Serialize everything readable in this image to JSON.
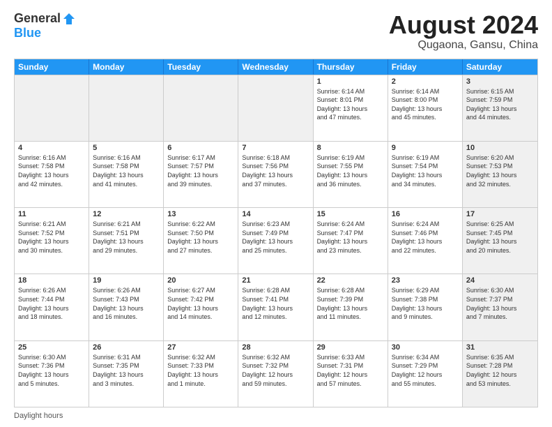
{
  "logo": {
    "general": "General",
    "blue": "Blue"
  },
  "title": "August 2024",
  "location": "Qugaona, Gansu, China",
  "header_days": [
    "Sunday",
    "Monday",
    "Tuesday",
    "Wednesday",
    "Thursday",
    "Friday",
    "Saturday"
  ],
  "footer": "Daylight hours",
  "weeks": [
    [
      {
        "day": "",
        "info": "",
        "shaded": true
      },
      {
        "day": "",
        "info": "",
        "shaded": true
      },
      {
        "day": "",
        "info": "",
        "shaded": true
      },
      {
        "day": "",
        "info": "",
        "shaded": true
      },
      {
        "day": "1",
        "info": "Sunrise: 6:14 AM\nSunset: 8:01 PM\nDaylight: 13 hours\nand 47 minutes.",
        "shaded": false
      },
      {
        "day": "2",
        "info": "Sunrise: 6:14 AM\nSunset: 8:00 PM\nDaylight: 13 hours\nand 45 minutes.",
        "shaded": false
      },
      {
        "day": "3",
        "info": "Sunrise: 6:15 AM\nSunset: 7:59 PM\nDaylight: 13 hours\nand 44 minutes.",
        "shaded": true
      }
    ],
    [
      {
        "day": "4",
        "info": "Sunrise: 6:16 AM\nSunset: 7:58 PM\nDaylight: 13 hours\nand 42 minutes.",
        "shaded": false
      },
      {
        "day": "5",
        "info": "Sunrise: 6:16 AM\nSunset: 7:58 PM\nDaylight: 13 hours\nand 41 minutes.",
        "shaded": false
      },
      {
        "day": "6",
        "info": "Sunrise: 6:17 AM\nSunset: 7:57 PM\nDaylight: 13 hours\nand 39 minutes.",
        "shaded": false
      },
      {
        "day": "7",
        "info": "Sunrise: 6:18 AM\nSunset: 7:56 PM\nDaylight: 13 hours\nand 37 minutes.",
        "shaded": false
      },
      {
        "day": "8",
        "info": "Sunrise: 6:19 AM\nSunset: 7:55 PM\nDaylight: 13 hours\nand 36 minutes.",
        "shaded": false
      },
      {
        "day": "9",
        "info": "Sunrise: 6:19 AM\nSunset: 7:54 PM\nDaylight: 13 hours\nand 34 minutes.",
        "shaded": false
      },
      {
        "day": "10",
        "info": "Sunrise: 6:20 AM\nSunset: 7:53 PM\nDaylight: 13 hours\nand 32 minutes.",
        "shaded": true
      }
    ],
    [
      {
        "day": "11",
        "info": "Sunrise: 6:21 AM\nSunset: 7:52 PM\nDaylight: 13 hours\nand 30 minutes.",
        "shaded": false
      },
      {
        "day": "12",
        "info": "Sunrise: 6:21 AM\nSunset: 7:51 PM\nDaylight: 13 hours\nand 29 minutes.",
        "shaded": false
      },
      {
        "day": "13",
        "info": "Sunrise: 6:22 AM\nSunset: 7:50 PM\nDaylight: 13 hours\nand 27 minutes.",
        "shaded": false
      },
      {
        "day": "14",
        "info": "Sunrise: 6:23 AM\nSunset: 7:49 PM\nDaylight: 13 hours\nand 25 minutes.",
        "shaded": false
      },
      {
        "day": "15",
        "info": "Sunrise: 6:24 AM\nSunset: 7:47 PM\nDaylight: 13 hours\nand 23 minutes.",
        "shaded": false
      },
      {
        "day": "16",
        "info": "Sunrise: 6:24 AM\nSunset: 7:46 PM\nDaylight: 13 hours\nand 22 minutes.",
        "shaded": false
      },
      {
        "day": "17",
        "info": "Sunrise: 6:25 AM\nSunset: 7:45 PM\nDaylight: 13 hours\nand 20 minutes.",
        "shaded": true
      }
    ],
    [
      {
        "day": "18",
        "info": "Sunrise: 6:26 AM\nSunset: 7:44 PM\nDaylight: 13 hours\nand 18 minutes.",
        "shaded": false
      },
      {
        "day": "19",
        "info": "Sunrise: 6:26 AM\nSunset: 7:43 PM\nDaylight: 13 hours\nand 16 minutes.",
        "shaded": false
      },
      {
        "day": "20",
        "info": "Sunrise: 6:27 AM\nSunset: 7:42 PM\nDaylight: 13 hours\nand 14 minutes.",
        "shaded": false
      },
      {
        "day": "21",
        "info": "Sunrise: 6:28 AM\nSunset: 7:41 PM\nDaylight: 13 hours\nand 12 minutes.",
        "shaded": false
      },
      {
        "day": "22",
        "info": "Sunrise: 6:28 AM\nSunset: 7:39 PM\nDaylight: 13 hours\nand 11 minutes.",
        "shaded": false
      },
      {
        "day": "23",
        "info": "Sunrise: 6:29 AM\nSunset: 7:38 PM\nDaylight: 13 hours\nand 9 minutes.",
        "shaded": false
      },
      {
        "day": "24",
        "info": "Sunrise: 6:30 AM\nSunset: 7:37 PM\nDaylight: 13 hours\nand 7 minutes.",
        "shaded": true
      }
    ],
    [
      {
        "day": "25",
        "info": "Sunrise: 6:30 AM\nSunset: 7:36 PM\nDaylight: 13 hours\nand 5 minutes.",
        "shaded": false
      },
      {
        "day": "26",
        "info": "Sunrise: 6:31 AM\nSunset: 7:35 PM\nDaylight: 13 hours\nand 3 minutes.",
        "shaded": false
      },
      {
        "day": "27",
        "info": "Sunrise: 6:32 AM\nSunset: 7:33 PM\nDaylight: 13 hours\nand 1 minute.",
        "shaded": false
      },
      {
        "day": "28",
        "info": "Sunrise: 6:32 AM\nSunset: 7:32 PM\nDaylight: 12 hours\nand 59 minutes.",
        "shaded": false
      },
      {
        "day": "29",
        "info": "Sunrise: 6:33 AM\nSunset: 7:31 PM\nDaylight: 12 hours\nand 57 minutes.",
        "shaded": false
      },
      {
        "day": "30",
        "info": "Sunrise: 6:34 AM\nSunset: 7:29 PM\nDaylight: 12 hours\nand 55 minutes.",
        "shaded": false
      },
      {
        "day": "31",
        "info": "Sunrise: 6:35 AM\nSunset: 7:28 PM\nDaylight: 12 hours\nand 53 minutes.",
        "shaded": true
      }
    ]
  ]
}
